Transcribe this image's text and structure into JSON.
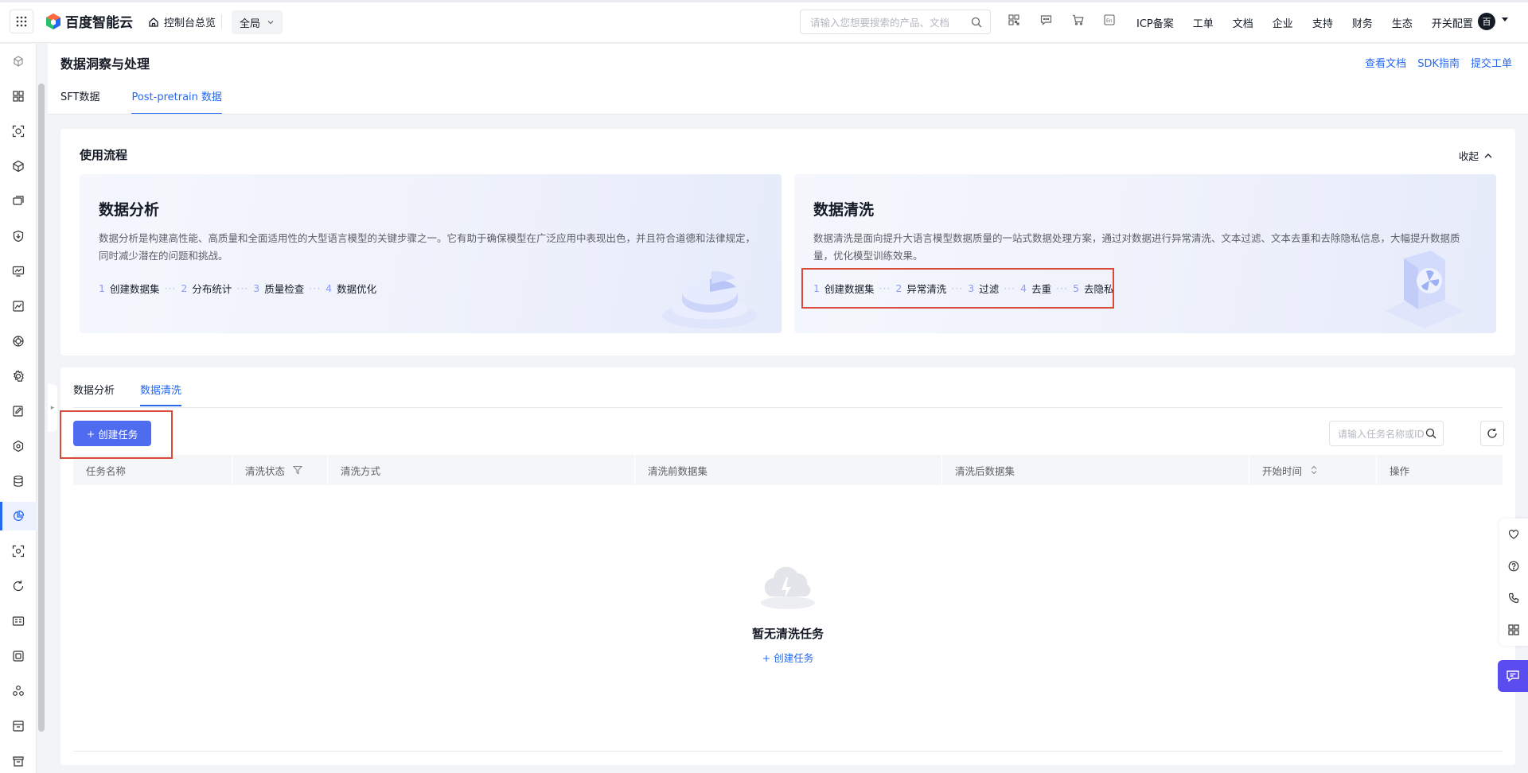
{
  "topbar": {
    "brand": "百度智能云",
    "console_home": "控制台总览",
    "region": "全局",
    "search_placeholder": "请输入您想要搜索的产品、文档",
    "nav": [
      "ICP备案",
      "工单",
      "文档",
      "企业",
      "支持",
      "财务",
      "生态",
      "开关配置"
    ],
    "avatar": "百",
    "icons": [
      "qrcode-icon",
      "message-icon",
      "cart-icon",
      "language-en-icon"
    ]
  },
  "page": {
    "title": "数据洞察与处理",
    "links": [
      "查看文档",
      "SDK指南",
      "提交工单"
    ],
    "tabs": [
      "SFT数据",
      "Post-pretrain 数据"
    ],
    "active_tab": 1
  },
  "flow": {
    "title": "使用流程",
    "collapse_label": "收起",
    "panels": [
      {
        "title": "数据分析",
        "desc": "数据分析是构建高性能、高质量和全面适用性的大型语言模型的关键步骤之一。它有助于确保模型在广泛应用中表现出色，并且符合道德和法律规定，同时减少潜在的问题和挑战。",
        "steps": [
          {
            "num": "1",
            "label": "创建数据集"
          },
          {
            "num": "2",
            "label": "分布统计"
          },
          {
            "num": "3",
            "label": "质量检查"
          },
          {
            "num": "4",
            "label": "数据优化"
          }
        ]
      },
      {
        "title": "数据清洗",
        "desc": "数据清洗是面向提升大语言模型数据质量的一站式数据处理方案，通过对数据进行异常清洗、文本过滤、文本去重和去除隐私信息，大幅提升数据质量，优化模型训练效果。",
        "steps": [
          {
            "num": "1",
            "label": "创建数据集"
          },
          {
            "num": "2",
            "label": "异常清洗"
          },
          {
            "num": "3",
            "label": "过滤"
          },
          {
            "num": "4",
            "label": "去重"
          },
          {
            "num": "5",
            "label": "去隐私"
          }
        ]
      }
    ]
  },
  "tasks": {
    "tabs": [
      "数据分析",
      "数据清洗"
    ],
    "active_tab": 1,
    "create_button": "创建任务",
    "search_placeholder": "请输入任务名称或ID",
    "columns": [
      "任务名称",
      "清洗状态",
      "清洗方式",
      "清洗前数据集",
      "清洗后数据集",
      "开始时间",
      "操作"
    ],
    "empty_title": "暂无清洗任务",
    "empty_link": "+ 创建任务"
  },
  "colors": {
    "accent": "#2468f2",
    "highlight_box": "#d94a3b",
    "chat_button": "#5b4cf0"
  }
}
